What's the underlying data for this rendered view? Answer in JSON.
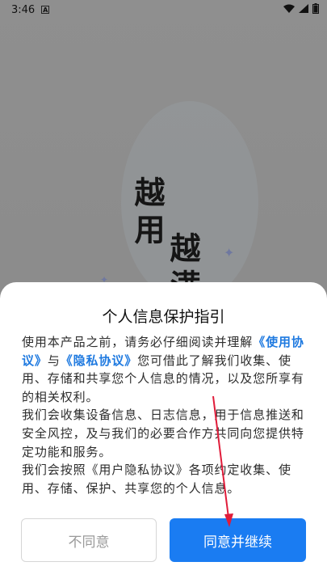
{
  "status_bar": {
    "time": "3:46",
    "notif_letter": "A"
  },
  "splash": {
    "line1": "越用",
    "line2": "越满"
  },
  "dialog": {
    "title": "个人信息保护指引",
    "para1_pre": "使用本产品之前，请务必仔细阅读并理解",
    "link_user": "《使用协议》",
    "para1_and": "与",
    "link_privacy": "《隐私协议》",
    "para1_post": "您可借此了解我们收集、使用、存储和共享您个人信息的情况，以及您所享有的相关权利。",
    "para2": "我们会收集设备信息、日志信息，用于信息推送和安全风控，及与我们的必要合作方共同向您提供特定功能和服务。",
    "para3": "我们会按照《用户隐私协议》各项约定收集、使用、存储、保护、共享您的个人信息。",
    "disagree_label": "不同意",
    "agree_label": "同意并继续"
  },
  "colors": {
    "accent": "#1a7cf2",
    "link": "#1f7ae0",
    "annotation": "#e01c3a"
  }
}
